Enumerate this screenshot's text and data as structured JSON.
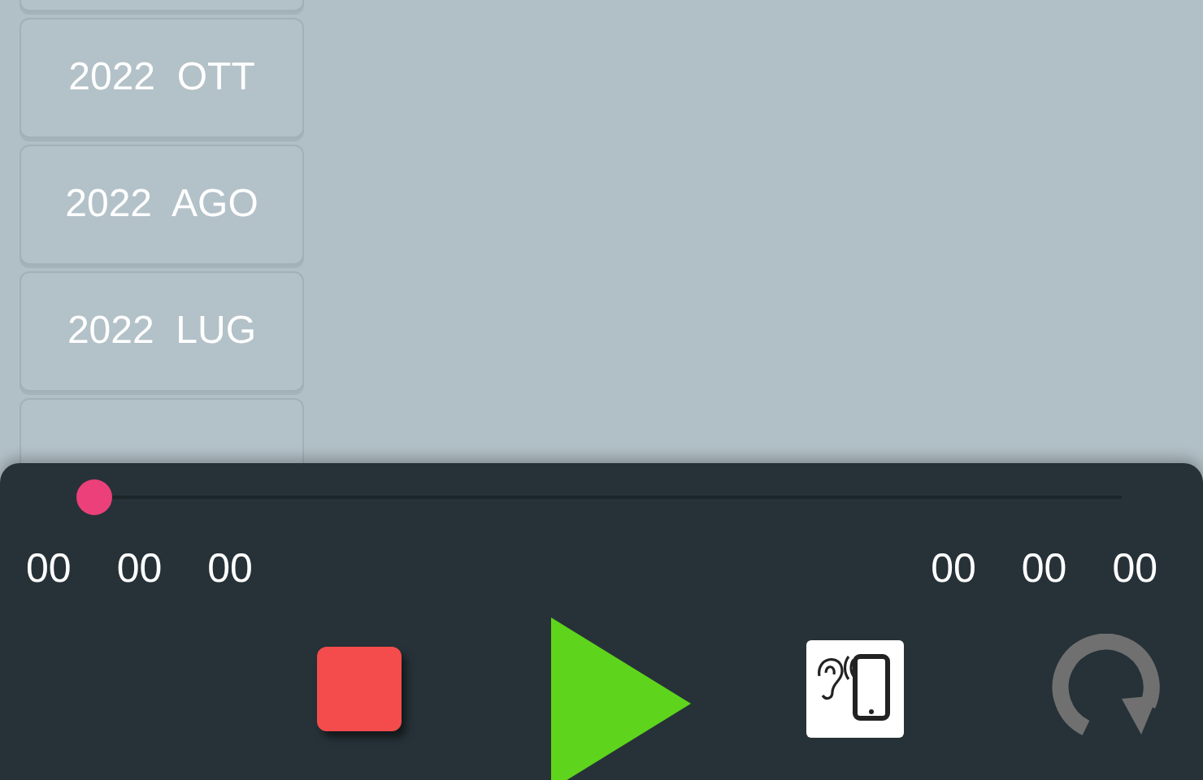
{
  "months": [
    {
      "label": "2022  OTT"
    },
    {
      "label": "2022  AGO"
    },
    {
      "label": "2022  LUG"
    }
  ],
  "player": {
    "level": 0,
    "elapsed": [
      "00",
      "00",
      "00"
    ],
    "total": [
      "00",
      "00",
      "00"
    ]
  }
}
